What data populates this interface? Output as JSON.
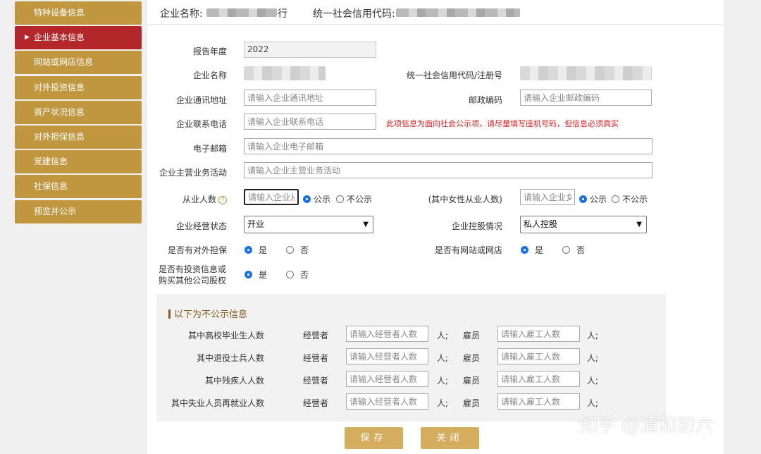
{
  "sidebar": {
    "items": [
      {
        "label": "特种设备信息",
        "active": false
      },
      {
        "label": "企业基本信息",
        "active": true
      },
      {
        "label": "网站或网店信息",
        "active": false
      },
      {
        "label": "对外投资信息",
        "active": false
      },
      {
        "label": "资产状况信息",
        "active": false
      },
      {
        "label": "对外担保信息",
        "active": false
      },
      {
        "label": "党建信息",
        "active": false
      },
      {
        "label": "社保信息",
        "active": false
      },
      {
        "label": "预览并公示",
        "active": false
      }
    ]
  },
  "topbar": {
    "company_label": "企业名称:",
    "company_tail": "行",
    "credit_label": "统一社会信用代码:"
  },
  "form": {
    "report_year_label": "报告年度",
    "report_year_value": "2022",
    "company_name_label": "企业名称",
    "credit_code_label": "统一社会信用代码/注册号",
    "address_label": "企业通讯地址",
    "address_placeholder": "请输入企业通讯地址",
    "postcode_label": "邮政编码",
    "postcode_placeholder": "请输入企业邮政编码",
    "phone_label": "企业联系电话",
    "phone_placeholder": "请输入企业联系电话",
    "phone_notice": "此项信息为面向社会公示项，请尽量填写座机号码，但信息必须真实",
    "email_label": "电子邮箱",
    "email_placeholder": "请输入企业电子邮箱",
    "business_label": "企业主营业务活动",
    "business_placeholder": "请输入企业主营业务活动",
    "employees_label": "从业人数",
    "employees_help_icon": "?",
    "employees_placeholder": "请输入企业从业人数",
    "public_label": "公示",
    "nonpublic_label": "不公示",
    "female_label": "(其中女性从业人数)",
    "female_placeholder": "请输入企业女性从业人数",
    "status_label": "企业经营状态",
    "status_value": "开业",
    "holding_label": "企业控股情况",
    "holding_value": "私人控股",
    "guarantee_label": "是否有对外担保",
    "website_label": "是否有网站或网店",
    "invest_label_1": "是否有投资信息或",
    "invest_label_2": "购买其他公司股权",
    "yes_label": "是",
    "no_label": "否"
  },
  "hidden_info": {
    "title": "以下为不公示信息",
    "operator_label": "经营者",
    "employee_label": "雇员",
    "operator_placeholder": "请输入经营者人数",
    "employee_placeholder": "请输入雇工人数",
    "unit_label": "人;",
    "rows": [
      {
        "label": "其中高校毕业生人数"
      },
      {
        "label": "其中退役士兵人数"
      },
      {
        "label": "其中残疾人人数"
      },
      {
        "label": "其中失业人员再就业人数"
      }
    ]
  },
  "buttons": {
    "save": "保存",
    "close": "关闭"
  },
  "watermark": "知乎 @清和初六"
}
